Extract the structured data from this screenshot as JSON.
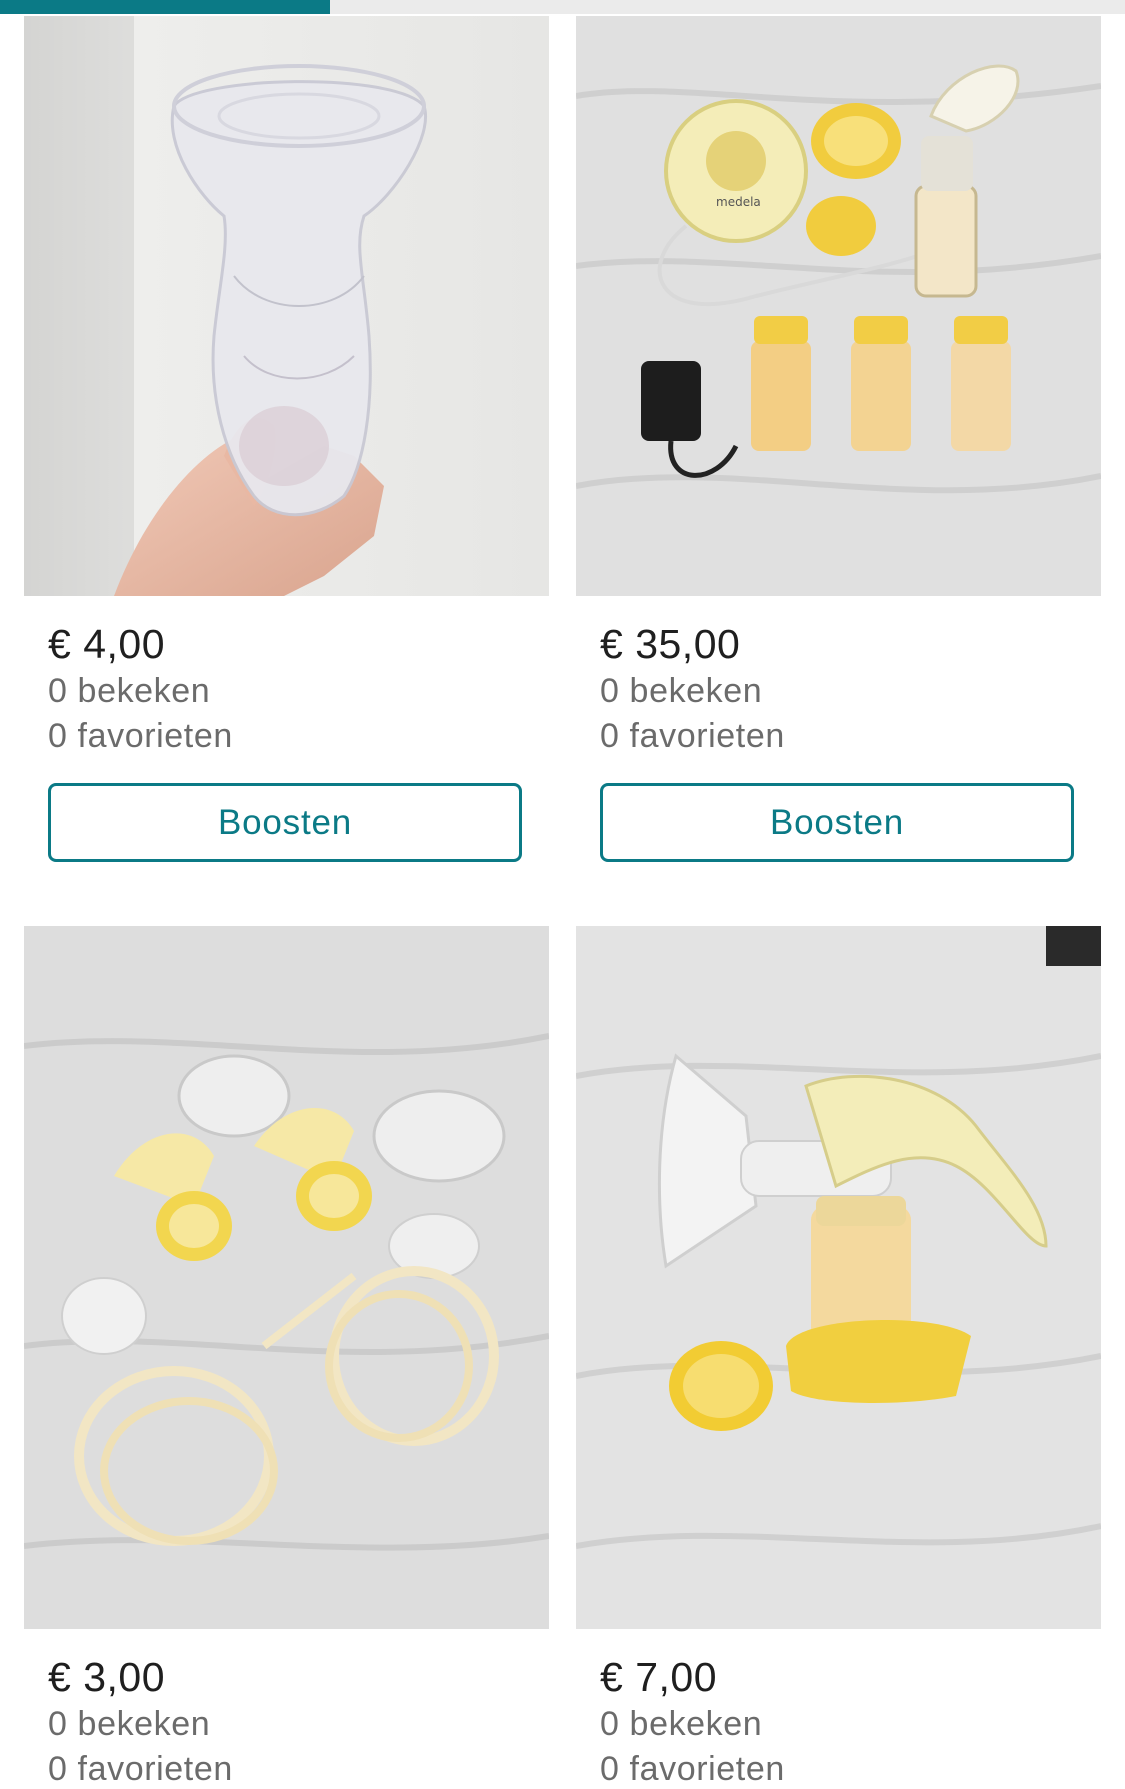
{
  "progress": {
    "fraction": 0.293,
    "color": "#0b7a86"
  },
  "listings": [
    {
      "price": "€ 4,00",
      "views": "0 bekeken",
      "favorites": "0 favorieten",
      "button": "Boosten"
    },
    {
      "price": "€ 35,00",
      "views": "0 bekeken",
      "favorites": "0 favorieten",
      "button": "Boosten"
    },
    {
      "price": "€ 3,00",
      "views": "0 bekeken",
      "favorites": "0 favorieten"
    },
    {
      "price": "€ 7,00",
      "views": "0 bekeken",
      "favorites": "0 favorieten"
    }
  ]
}
